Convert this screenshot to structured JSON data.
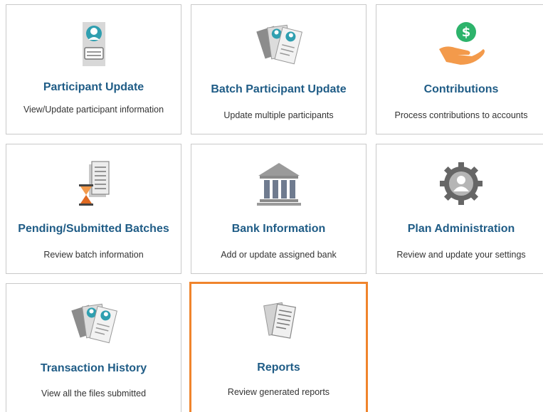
{
  "tiles": [
    {
      "title": "Participant Update",
      "description": "View/Update participant information",
      "icon": "participant-card-icon"
    },
    {
      "title": "Batch Participant Update",
      "description": "Update multiple participants",
      "icon": "batch-documents-icon"
    },
    {
      "title": "Contributions",
      "description": "Process contributions to accounts",
      "icon": "hand-dollar-icon"
    },
    {
      "title": "Pending/Submitted Batches",
      "description": "Review batch information",
      "icon": "hourglass-document-icon"
    },
    {
      "title": "Bank Information",
      "description": "Add or update assigned bank",
      "icon": "bank-icon"
    },
    {
      "title": "Plan Administration",
      "description": "Review and update your settings",
      "icon": "gear-user-icon"
    },
    {
      "title": "Transaction History",
      "description": "View all the files submitted",
      "icon": "history-documents-icon"
    },
    {
      "title": "Reports",
      "description": "Review generated reports",
      "icon": "reports-icon"
    }
  ],
  "selected_tile": "Reports",
  "colors": {
    "title": "#1f5c86",
    "border": "#c9c9c9",
    "selected_border": "#f0842c",
    "teal": "#2f9fb0",
    "orange": "#f39a4b",
    "green": "#2db36b",
    "gray": "#7a7a7a"
  }
}
